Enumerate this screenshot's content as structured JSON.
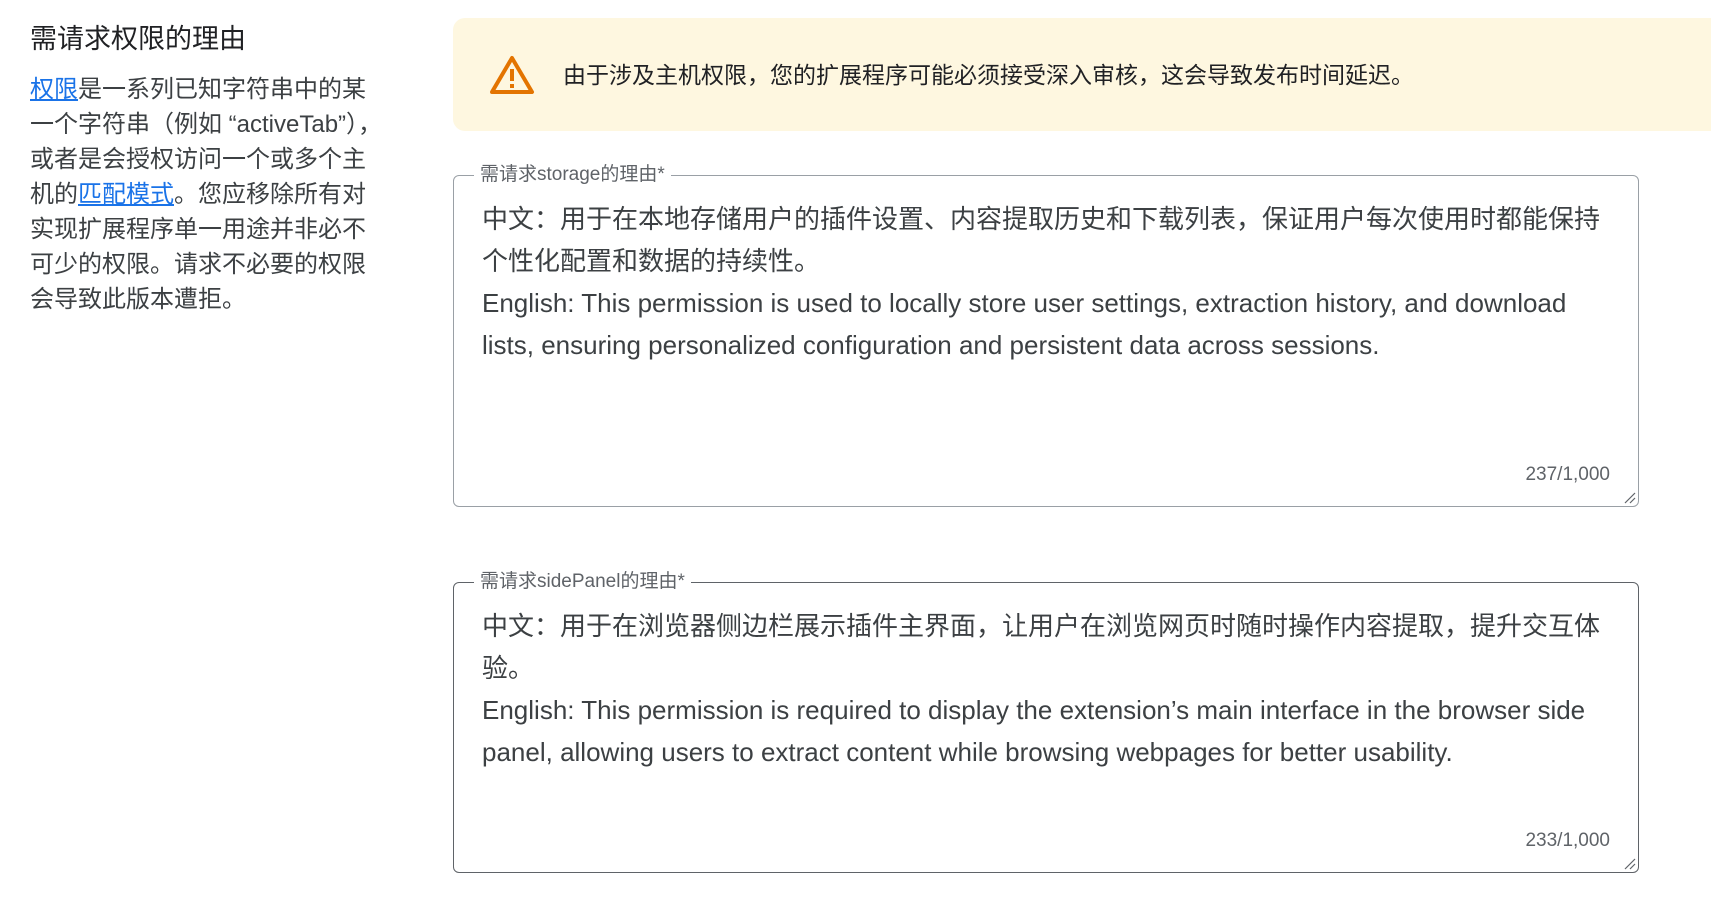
{
  "sidebar": {
    "title": "需请求权限的理由",
    "desc_link1": "权限",
    "desc_part1": "是一系列已知字符串中的某一个字符串（例如 “activeTab”），或者是会授权访问一个或多个主机的",
    "desc_link2": "匹配模式",
    "desc_part2": "。您应移除所有对实现扩展程序单一用途并非必不可少的权限。请求不必要的权限会导致此版本遭拒。"
  },
  "warning": {
    "icon": "warning-triangle-icon",
    "color": "#e37400",
    "text": "由于涉及主机权限，您的扩展程序可能必须接受深入审核，这会导致发布时间延迟。"
  },
  "fields": [
    {
      "label": "需请求storage的理由*",
      "value": "中文：用于在本地存储用户的插件设置、内容提取历史和下载列表，保证用户每次使用时都能保持个性化配置和数据的持续性。\nEnglish: This permission is used to locally store user settings, extraction history, and download lists, ensuring personalized configuration and persistent data across sessions.",
      "counter": "237/1,000"
    },
    {
      "label": "需请求sidePanel的理由*",
      "value": "中文：用于在浏览器侧边栏展示插件主界面，让用户在浏览网页时随时操作内容提取，提升交互体验。\nEnglish: This permission is required to display the extension’s main interface in the browser side panel, allowing users to extract content while browsing webpages for better usability.",
      "counter": "233/1,000"
    }
  ]
}
